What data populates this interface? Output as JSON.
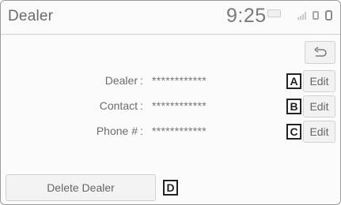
{
  "header": {
    "title": "Dealer",
    "clock": "9:25",
    "status_icons": [
      "badge-icon",
      "signal-icon",
      "phone-icon",
      "battery-icon"
    ]
  },
  "back_button": {
    "icon": "back-arrow-icon"
  },
  "fields": [
    {
      "label": "Dealer",
      "colon": ":",
      "value": "************",
      "callout": "A",
      "edit_label": "Edit"
    },
    {
      "label": "Contact",
      "colon": ":",
      "value": "************",
      "callout": "B",
      "edit_label": "Edit"
    },
    {
      "label": "Phone #",
      "colon": ":",
      "value": "************",
      "callout": "C",
      "edit_label": "Edit"
    }
  ],
  "delete_button": {
    "label": "Delete Dealer",
    "callout": "D"
  },
  "colors": {
    "background": "#fbfbfb",
    "button_fill": "#f2f2f2",
    "text": "#666666",
    "callout_border": "#222222"
  }
}
